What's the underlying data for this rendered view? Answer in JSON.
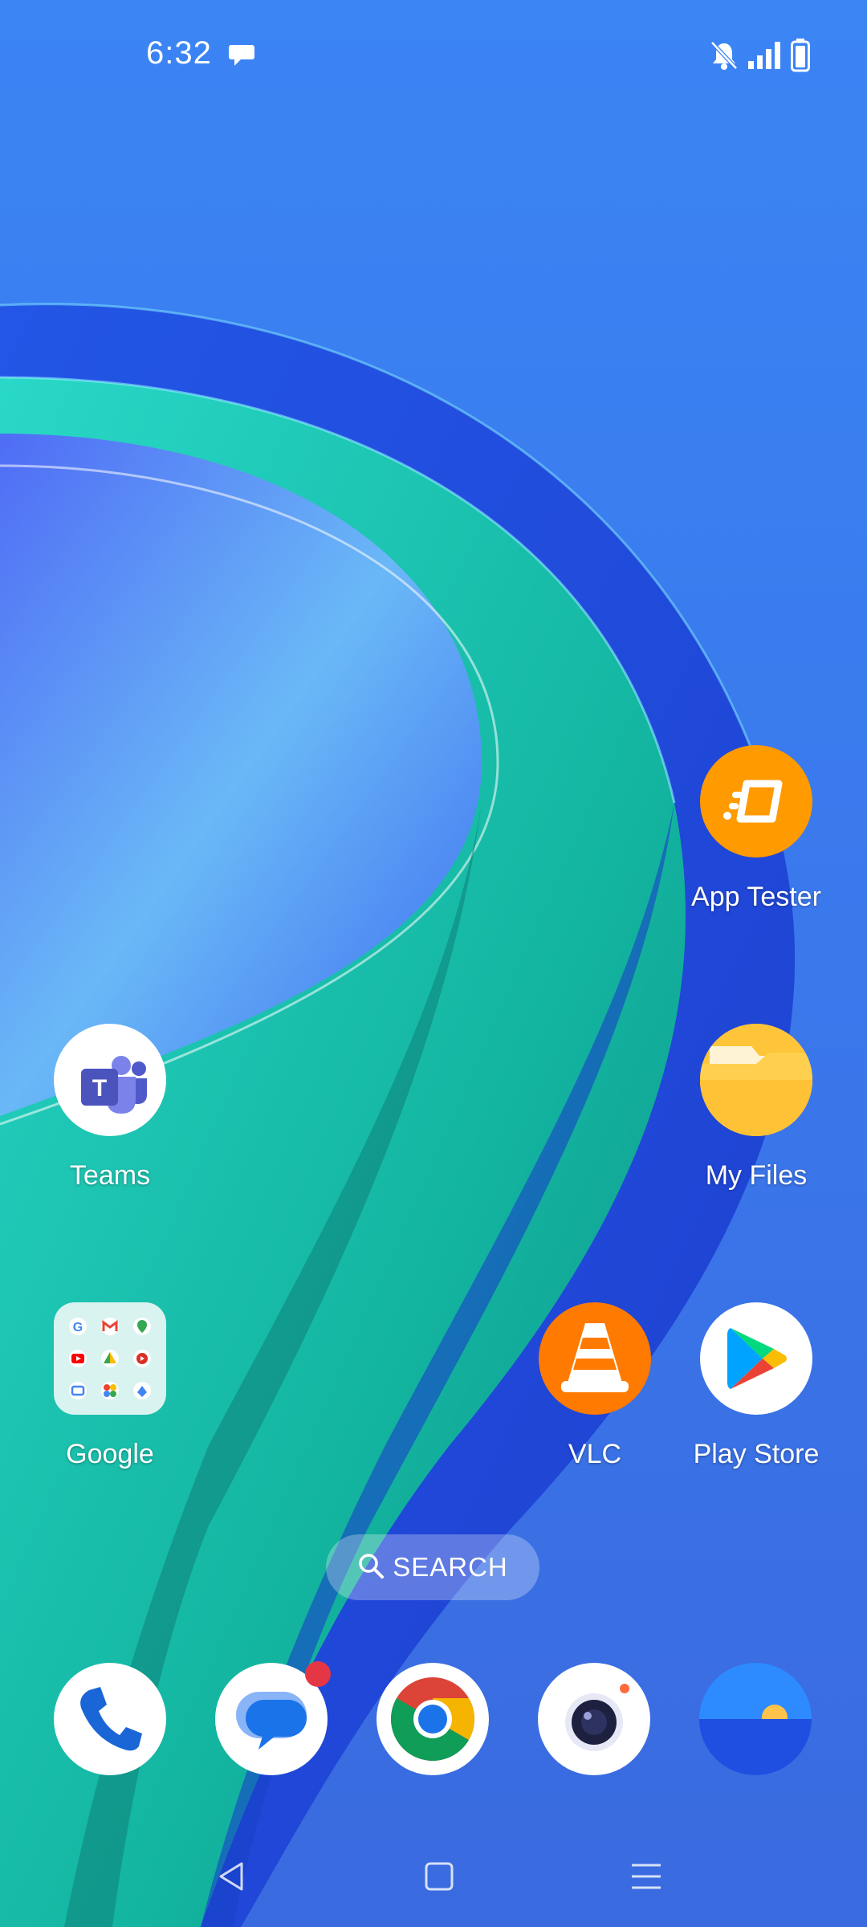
{
  "status_bar": {
    "time": "6:32",
    "icons": [
      "chat-notification-icon",
      "bell-muted-icon",
      "signal-icon",
      "battery-icon"
    ]
  },
  "apps": [
    {
      "label": "App Tester",
      "icon": "app-tester-icon",
      "color": "#FF9A00"
    },
    {
      "label": "Teams",
      "icon": "teams-icon",
      "color": "#5059C9"
    },
    {
      "label": "My Files",
      "icon": "folder-icon",
      "color": "#FFC53A"
    },
    {
      "label": "Google",
      "icon": "google-folder-icon",
      "color": "#D9F3F0"
    },
    {
      "label": "VLC",
      "icon": "vlc-cone-icon",
      "color": "#FF7A00"
    },
    {
      "label": "Play Store",
      "icon": "play-store-icon",
      "color": "#FFFFFF"
    }
  ],
  "search": {
    "label": "SEARCH",
    "icon": "search-icon"
  },
  "dock": [
    {
      "name": "phone",
      "icon": "phone-icon"
    },
    {
      "name": "messages",
      "icon": "messages-icon",
      "has_badge": true
    },
    {
      "name": "chrome",
      "icon": "chrome-icon"
    },
    {
      "name": "camera",
      "icon": "camera-icon"
    },
    {
      "name": "weather",
      "icon": "weather-sun-icon"
    }
  ],
  "nav": [
    "back-icon",
    "home-icon",
    "recents-icon"
  ],
  "colors": {
    "wallpaper_blue": "#3A7FF2",
    "wallpaper_teal": "#1FC9B0",
    "accent_badge": "#E53645"
  }
}
